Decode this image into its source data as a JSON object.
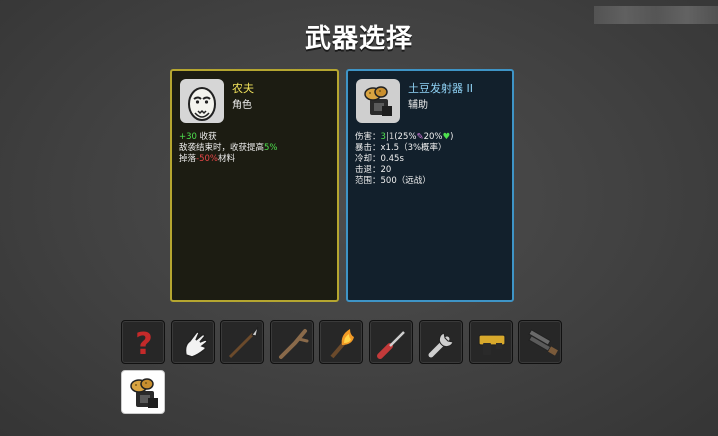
{
  "title": "武器选择",
  "character": {
    "name": "农夫",
    "type": "角色",
    "lines": [
      {
        "a": "+30",
        "b": " 收获",
        "c": "",
        "d": ""
      },
      {
        "a": "",
        "b": "敌袭结束时，收获提高",
        "c": "5%",
        "d": ""
      },
      {
        "a": "",
        "b": "掉落",
        "c": "-50%",
        "d": "材料"
      }
    ]
  },
  "weapon": {
    "name": "土豆发射器 II",
    "type": "辅助",
    "damage_label": "伤害：",
    "damage_value": "3",
    "damage_sep": "|",
    "damage_alt": "1",
    "damage_scaling": "(25%",
    "damage_scaling2": "20%",
    "damage_close": ")",
    "crit_label": "暴击：",
    "crit_value": "x1.5（3%概率）",
    "cooldown_label": "冷却：",
    "cooldown_value": "0.45s",
    "knockback_label": "击退：",
    "knockback_value": "20",
    "range_label": "范围：",
    "range_value": "500（远战）"
  },
  "weapon_slots": [
    {
      "icon": "random-question-icon"
    },
    {
      "icon": "hand-icon"
    },
    {
      "icon": "spear-icon"
    },
    {
      "icon": "stick-icon"
    },
    {
      "icon": "torch-icon"
    },
    {
      "icon": "screwdriver-icon"
    },
    {
      "icon": "wrench-icon"
    },
    {
      "icon": "taser-icon"
    },
    {
      "icon": "double-barrel-shotgun-icon"
    },
    {
      "icon": "potato-thrower-icon",
      "selected": true
    }
  ],
  "colors": {
    "character_border": "#b5a630",
    "weapon_border": "#3e94c6",
    "positive": "#4ee04e",
    "negative": "#e84848"
  }
}
